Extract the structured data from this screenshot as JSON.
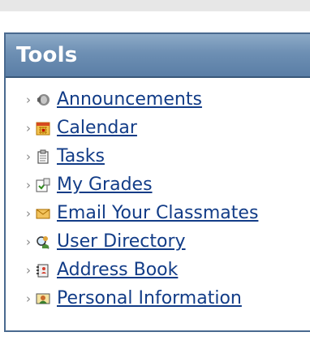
{
  "panel": {
    "title": "Tools"
  },
  "tools": [
    {
      "label": "Announcements",
      "icon": "megaphone-icon"
    },
    {
      "label": "Calendar",
      "icon": "calendar-icon"
    },
    {
      "label": "Tasks",
      "icon": "clipboard-icon"
    },
    {
      "label": "My Grades",
      "icon": "gradebook-icon"
    },
    {
      "label": "Email Your Classmates",
      "icon": "envelope-icon"
    },
    {
      "label": "User Directory",
      "icon": "user-search-icon"
    },
    {
      "label": "Address Book",
      "icon": "address-book-icon"
    },
    {
      "label": "Personal Information",
      "icon": "personal-info-icon"
    }
  ],
  "colors": {
    "header_background": "#6d8fb3",
    "header_text": "#ffffff",
    "link": "#123c87",
    "chevron": "#888888",
    "panel_border": "#4a6a8f"
  }
}
